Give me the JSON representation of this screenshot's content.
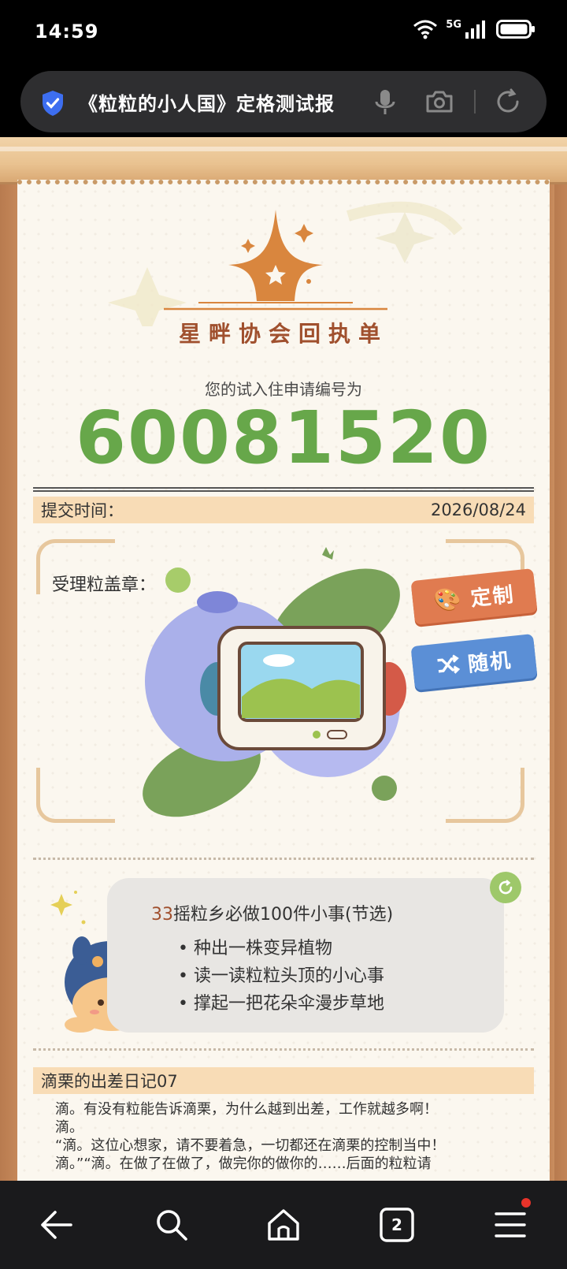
{
  "status_bar": {
    "time": "14:59",
    "network": "5G"
  },
  "browser": {
    "url_text": "《粒粒的小人国》定格测试报"
  },
  "receipt": {
    "logo_title": "星畔协会回执单",
    "subtitle": "您的试入住申请编号为",
    "application_number": "60081520",
    "submit_label": "提交时间：",
    "submit_date": "2026/08/24",
    "stamp_label": "受理粒盖章："
  },
  "actions": {
    "custom_label": "定制",
    "random_label": "随机"
  },
  "todo": {
    "count": "33",
    "title": "摇粒乡必做100件小事(节选)",
    "items": [
      "种出一株变异植物",
      "读一读粒粒头顶的小心事",
      "撑起一把花朵伞漫步草地"
    ]
  },
  "diary": {
    "title": "滴栗的出差日记07",
    "lines": [
      "滴。有没有粒能告诉滴栗，为什么越到出差，工作就越多啊！",
      "滴。",
      "“滴。这位心想家，请不要着急，一切都还在滴栗的控制当中！",
      "滴。”“滴。在做了在做了，做完你的做你的……后面的粒粒请"
    ]
  },
  "bottom_nav": {
    "tab_count": "2"
  },
  "colors": {
    "accent_green": "#67a74a",
    "brand_brown": "#a0502e",
    "custom_orange": "#e07b50",
    "random_blue": "#5b8fd6"
  }
}
